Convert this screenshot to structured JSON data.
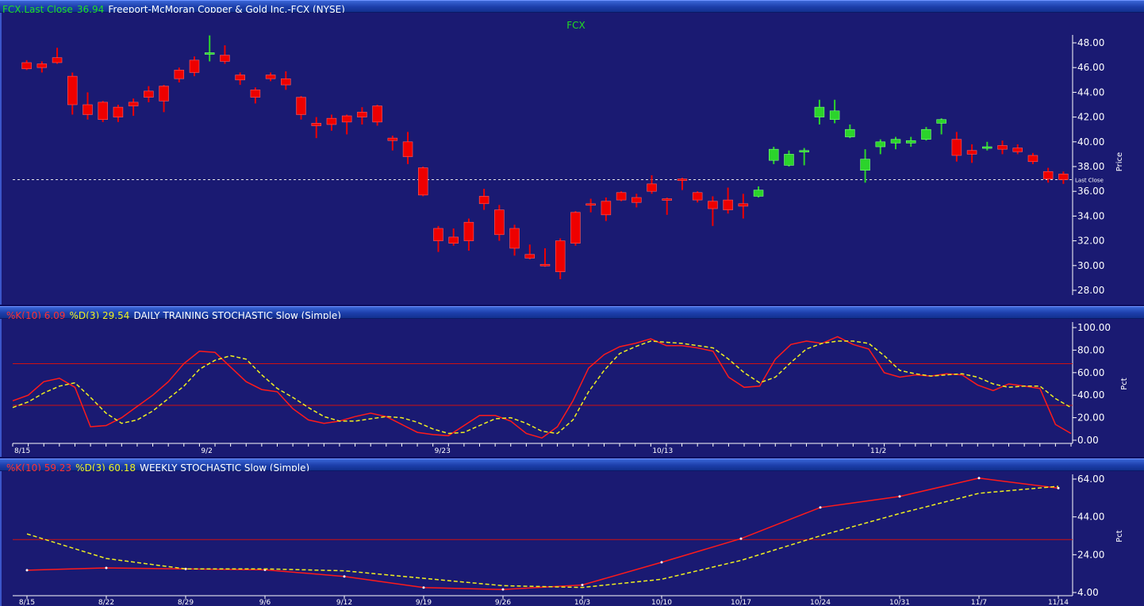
{
  "colors": {
    "background": "#1a1a72",
    "up": "#2bd42b",
    "down": "#ee0000",
    "k_line": "#ff1a1a",
    "d_line": "#f0f020",
    "ref_line": "#d01010",
    "last_close_line": "#e8e8e8",
    "title_green": "#22dd22",
    "title_red": "#ff3030",
    "title_yellow": "#f0f020"
  },
  "header": {
    "symbol_label": "FCX.Last Close",
    "last_close_value": "36.94",
    "company": "Freeport-McMoran Copper & Gold Inc.-FCX (NYSE)"
  },
  "daily_header": {
    "k_label": "%K(10) 6.09",
    "d_label": "%D(3) 29.54",
    "title": "DAILY TRAINING STOCHASTIC Slow (Simple)"
  },
  "weekly_header": {
    "k_label": "%K(10) 59.23",
    "d_label": "%D(3) 60.18",
    "title": "WEEKLY STOCHASTIC Slow (Simple)"
  },
  "chart_data": [
    {
      "type": "candlestick",
      "title": "FCX",
      "ylabel": "Price",
      "ylim": [
        28,
        48
      ],
      "yticks": [
        "48.00",
        "46.00",
        "44.00",
        "42.00",
        "40.00",
        "38.00",
        "36.00",
        "34.00",
        "32.00",
        "30.00",
        "28.00"
      ],
      "last_close": 36.94,
      "last_close_label": "Last Close",
      "candles": [
        {
          "o": 46.4,
          "h": 46.6,
          "l": 45.8,
          "c": 45.9
        },
        {
          "o": 46.3,
          "h": 46.5,
          "l": 45.6,
          "c": 46.0
        },
        {
          "o": 46.8,
          "h": 47.6,
          "l": 46.3,
          "c": 46.4
        },
        {
          "o": 45.3,
          "h": 45.6,
          "l": 42.2,
          "c": 43.0
        },
        {
          "o": 43.0,
          "h": 44.0,
          "l": 41.8,
          "c": 42.2
        },
        {
          "o": 43.2,
          "h": 43.3,
          "l": 41.6,
          "c": 41.8
        },
        {
          "o": 42.8,
          "h": 43.0,
          "l": 41.6,
          "c": 42.0
        },
        {
          "o": 43.2,
          "h": 43.5,
          "l": 42.1,
          "c": 42.9
        },
        {
          "o": 44.1,
          "h": 44.5,
          "l": 43.2,
          "c": 43.6
        },
        {
          "o": 44.5,
          "h": 44.6,
          "l": 42.4,
          "c": 43.3
        },
        {
          "o": 45.8,
          "h": 46.0,
          "l": 44.8,
          "c": 45.1
        },
        {
          "o": 46.6,
          "h": 46.9,
          "l": 45.3,
          "c": 45.6
        },
        {
          "o": 47.2,
          "h": 48.6,
          "l": 46.5,
          "c": 47.2
        },
        {
          "o": 47.0,
          "h": 47.8,
          "l": 46.3,
          "c": 46.5
        },
        {
          "o": 45.4,
          "h": 45.6,
          "l": 44.6,
          "c": 45.0
        },
        {
          "o": 44.2,
          "h": 44.4,
          "l": 43.1,
          "c": 43.6
        },
        {
          "o": 45.4,
          "h": 45.6,
          "l": 44.9,
          "c": 45.1
        },
        {
          "o": 45.1,
          "h": 45.7,
          "l": 44.2,
          "c": 44.6
        },
        {
          "o": 43.6,
          "h": 43.7,
          "l": 41.8,
          "c": 42.2
        },
        {
          "o": 41.5,
          "h": 42.0,
          "l": 40.3,
          "c": 41.3
        },
        {
          "o": 41.9,
          "h": 42.2,
          "l": 40.9,
          "c": 41.4
        },
        {
          "o": 42.1,
          "h": 42.2,
          "l": 40.6,
          "c": 41.6
        },
        {
          "o": 42.4,
          "h": 42.8,
          "l": 41.4,
          "c": 42.0
        },
        {
          "o": 42.9,
          "h": 43.0,
          "l": 41.3,
          "c": 41.6
        },
        {
          "o": 40.3,
          "h": 40.5,
          "l": 39.3,
          "c": 40.1
        },
        {
          "o": 40.0,
          "h": 40.8,
          "l": 38.2,
          "c": 38.8
        },
        {
          "o": 37.9,
          "h": 38.0,
          "l": 35.6,
          "c": 35.7
        },
        {
          "o": 33.0,
          "h": 33.2,
          "l": 31.1,
          "c": 32.0
        },
        {
          "o": 32.3,
          "h": 33.0,
          "l": 31.6,
          "c": 31.8
        },
        {
          "o": 33.5,
          "h": 33.8,
          "l": 31.2,
          "c": 32.0
        },
        {
          "o": 35.6,
          "h": 36.2,
          "l": 34.5,
          "c": 35.0
        },
        {
          "o": 34.5,
          "h": 34.9,
          "l": 32.0,
          "c": 32.5
        },
        {
          "o": 33.0,
          "h": 33.3,
          "l": 30.8,
          "c": 31.4
        },
        {
          "o": 30.9,
          "h": 31.7,
          "l": 30.5,
          "c": 30.6
        },
        {
          "o": 30.1,
          "h": 31.4,
          "l": 29.9,
          "c": 30.0
        },
        {
          "o": 32.0,
          "h": 32.2,
          "l": 28.9,
          "c": 29.5
        },
        {
          "o": 34.3,
          "h": 34.4,
          "l": 31.6,
          "c": 31.8
        },
        {
          "o": 35.0,
          "h": 35.4,
          "l": 34.3,
          "c": 34.9
        },
        {
          "o": 35.2,
          "h": 35.5,
          "l": 33.6,
          "c": 34.1
        },
        {
          "o": 35.9,
          "h": 36.0,
          "l": 35.2,
          "c": 35.3
        },
        {
          "o": 35.5,
          "h": 35.8,
          "l": 34.7,
          "c": 35.1
        },
        {
          "o": 36.6,
          "h": 37.3,
          "l": 35.8,
          "c": 36.0
        },
        {
          "o": 35.4,
          "h": 35.5,
          "l": 34.1,
          "c": 35.3
        },
        {
          "o": 37.0,
          "h": 37.1,
          "l": 36.1,
          "c": 36.9
        },
        {
          "o": 35.9,
          "h": 36.0,
          "l": 35.1,
          "c": 35.3
        },
        {
          "o": 35.2,
          "h": 35.6,
          "l": 33.2,
          "c": 34.6
        },
        {
          "o": 35.3,
          "h": 36.3,
          "l": 34.2,
          "c": 34.5
        },
        {
          "o": 35.0,
          "h": 35.8,
          "l": 33.8,
          "c": 34.8
        },
        {
          "o": 35.6,
          "h": 36.4,
          "l": 35.5,
          "c": 36.1
        },
        {
          "o": 38.5,
          "h": 39.6,
          "l": 38.2,
          "c": 39.4
        },
        {
          "o": 38.1,
          "h": 39.3,
          "l": 38.0,
          "c": 39.0
        },
        {
          "o": 39.2,
          "h": 39.5,
          "l": 38.1,
          "c": 39.3
        },
        {
          "o": 42.0,
          "h": 43.4,
          "l": 41.4,
          "c": 42.8
        },
        {
          "o": 41.8,
          "h": 43.4,
          "l": 41.5,
          "c": 42.5
        },
        {
          "o": 40.4,
          "h": 41.4,
          "l": 40.3,
          "c": 41.0
        },
        {
          "o": 37.7,
          "h": 39.4,
          "l": 36.7,
          "c": 38.6
        },
        {
          "o": 39.6,
          "h": 40.2,
          "l": 39.0,
          "c": 40.0
        },
        {
          "o": 39.9,
          "h": 40.4,
          "l": 39.4,
          "c": 40.2
        },
        {
          "o": 39.9,
          "h": 40.4,
          "l": 39.6,
          "c": 40.1
        },
        {
          "o": 40.2,
          "h": 41.2,
          "l": 40.1,
          "c": 41.0
        },
        {
          "o": 41.5,
          "h": 41.9,
          "l": 40.6,
          "c": 41.8
        },
        {
          "o": 40.2,
          "h": 40.8,
          "l": 38.4,
          "c": 38.9
        },
        {
          "o": 39.3,
          "h": 39.8,
          "l": 38.3,
          "c": 39.0
        },
        {
          "o": 39.6,
          "h": 40.0,
          "l": 39.3,
          "c": 39.6
        },
        {
          "o": 39.7,
          "h": 40.1,
          "l": 39.0,
          "c": 39.4
        },
        {
          "o": 39.5,
          "h": 39.8,
          "l": 39.0,
          "c": 39.2
        },
        {
          "o": 38.9,
          "h": 39.1,
          "l": 38.2,
          "c": 38.4
        },
        {
          "o": 37.6,
          "h": 37.9,
          "l": 36.7,
          "c": 37.0
        },
        {
          "o": 37.4,
          "h": 37.6,
          "l": 36.6,
          "c": 36.94
        }
      ]
    },
    {
      "type": "line",
      "title": "DAILY TRAINING STOCHASTIC Slow (Simple)",
      "ylabel": "Pct",
      "ylim": [
        0,
        100
      ],
      "yticks": [
        "100.00",
        "80.00",
        "60.00",
        "40.00",
        "20.00",
        "0.00"
      ],
      "xticks": [
        "8/15",
        "9/2",
        "9/23",
        "10/13",
        "11/2"
      ],
      "xtick_index": [
        0,
        12,
        27,
        41,
        55
      ],
      "reference_lines": [
        68,
        31
      ],
      "series": [
        {
          "name": "%K(10)",
          "style": "solid",
          "values": [
            35,
            40,
            52,
            55,
            47,
            12,
            13,
            20,
            30,
            40,
            52,
            68,
            79,
            78,
            65,
            52,
            45,
            43,
            28,
            18,
            15,
            17,
            21,
            24,
            21,
            14,
            7,
            5,
            4,
            13,
            22,
            22,
            17,
            6,
            2,
            12,
            35,
            64,
            76,
            83,
            86,
            90,
            84,
            84,
            82,
            79,
            56,
            47,
            48,
            72,
            85,
            88,
            86,
            92,
            85,
            81,
            60,
            56,
            58,
            57,
            59,
            58,
            49,
            44,
            50,
            48,
            46,
            14,
            6
          ]
        },
        {
          "name": "%D(3)",
          "style": "dashed",
          "values": [
            29,
            34,
            42,
            48,
            51,
            38,
            24,
            15,
            18,
            26,
            37,
            48,
            63,
            71,
            75,
            72,
            58,
            46,
            38,
            29,
            21,
            17,
            17,
            19,
            21,
            20,
            16,
            10,
            6,
            7,
            13,
            19,
            20,
            15,
            8,
            6,
            18,
            43,
            62,
            77,
            83,
            88,
            87,
            86,
            84,
            82,
            72,
            60,
            51,
            56,
            69,
            81,
            86,
            88,
            88,
            86,
            75,
            62,
            59,
            57,
            58,
            59,
            56,
            50,
            47,
            48,
            48,
            37,
            29
          ]
        }
      ]
    },
    {
      "type": "line",
      "title": "WEEKLY STOCHASTIC Slow (Simple)",
      "ylabel": "Pct",
      "ylim": [
        4,
        64
      ],
      "yticks": [
        "64.00",
        "44.00",
        "24.00",
        "4.00"
      ],
      "x": [
        "8/15",
        "8/22",
        "8/29",
        "9/6",
        "9/12",
        "9/19",
        "9/26",
        "10/3",
        "10/10",
        "10/17",
        "10/24",
        "10/31",
        "11/7",
        "11/14"
      ],
      "reference_lines": [
        32
      ],
      "series": [
        {
          "name": "%K(10)",
          "style": "solid",
          "values": [
            15.8,
            17,
            16.5,
            16,
            12.5,
            6.6,
            5.6,
            8,
            20,
            32.5,
            49,
            54.8,
            64.5,
            59.23
          ]
        },
        {
          "name": "%D(3)",
          "style": "dashed",
          "values": [
            35,
            22,
            16.5,
            16.5,
            15.5,
            11.5,
            7.6,
            6.7,
            11,
            21,
            34,
            45.8,
            56.5,
            60.18
          ]
        }
      ]
    }
  ]
}
